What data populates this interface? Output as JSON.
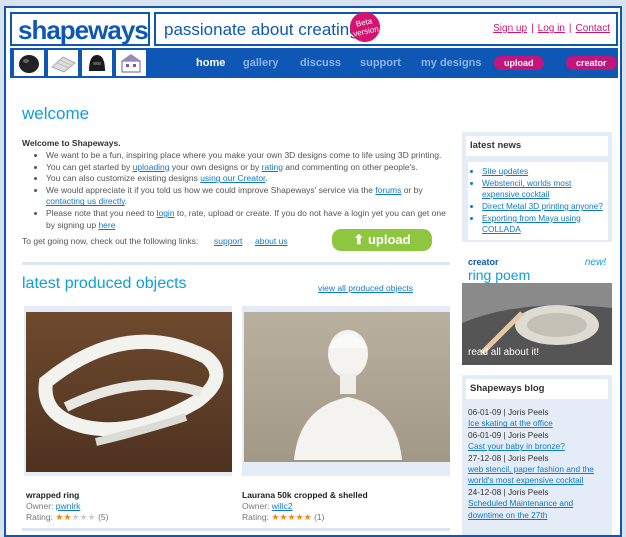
{
  "header": {
    "logo": "shapeways",
    "tagline": "passionate about creating",
    "beta_badge": "Beta version",
    "links": [
      "Sign up",
      "Log in",
      "Contact"
    ]
  },
  "nav": {
    "thumbnails": [
      "helmet-thumbnail",
      "mesh-thumbnail",
      "vader-thumbnail",
      "house-thumbnail"
    ],
    "items": [
      {
        "label": "home",
        "active": true
      },
      {
        "label": "gallery",
        "active": false
      },
      {
        "label": "discuss",
        "active": false
      },
      {
        "label": "support",
        "active": false
      },
      {
        "label": "my designs",
        "active": false
      }
    ],
    "upload_label": "upload",
    "creator_label": "creator"
  },
  "welcome": {
    "heading": "welcome",
    "intro_title": "Welcome to Shapeways.",
    "bullets": [
      {
        "parts": [
          {
            "t": "We want to be a fun, inspiring place where you make your own 3D designs come to life using 3D printing."
          }
        ]
      },
      {
        "parts": [
          {
            "t": "You can get started by "
          },
          {
            "t": "uploading",
            "link": true
          },
          {
            "t": " your own designs or by "
          },
          {
            "t": "rating",
            "link": true
          },
          {
            "t": " and commenting on other people's."
          }
        ]
      },
      {
        "parts": [
          {
            "t": "You can also customize existing designs "
          },
          {
            "t": "using our Creator",
            "link": true
          },
          {
            "t": "."
          }
        ]
      },
      {
        "parts": [
          {
            "t": "We would appreciate it if you told us how we could improve Shapeways' service via the "
          },
          {
            "t": "forums",
            "link": true
          },
          {
            "t": " or by "
          },
          {
            "t": "contacting us directly",
            "link": true
          },
          {
            "t": "."
          }
        ]
      },
      {
        "parts": [
          {
            "t": "Please note that you need to "
          },
          {
            "t": "login",
            "link": true
          },
          {
            "t": " to, rate, upload or create. If you do not have a login yet you can get one by signing up "
          },
          {
            "t": "here",
            "link": true
          }
        ]
      }
    ],
    "get_going": "To get going now, check out the following links:",
    "get_going_links": [
      "support",
      "about us"
    ],
    "upload_button": "upload"
  },
  "produced": {
    "heading": "latest produced objects",
    "view_all": "view all produced objects",
    "owner_label": "Owner:",
    "rating_label": "Rating:",
    "items": [
      {
        "title": "wrapped ring",
        "owner": "pwnlrk",
        "rating": 2,
        "max": 5,
        "votes": "(5)"
      },
      {
        "title": "Laurana 50k cropped & shelled",
        "owner": "willc2",
        "rating": 5,
        "max": 5,
        "votes": "(1)"
      }
    ]
  },
  "sidebar": {
    "news_title": "latest news",
    "news": [
      "Site updates",
      "Webstencil, worlds most expensive cocktail",
      "Direct Metal 3D printing anyone?",
      "Exporting from Maya using COLLADA"
    ],
    "creator_kicker": "creator",
    "creator_title": "ring poem",
    "creator_new": "new!",
    "creator_read": "read all about it!",
    "blog_title": "Shapeways blog",
    "blog": [
      {
        "meta": "06-01-09 | Joris Peels",
        "post": "Ice skating at the office"
      },
      {
        "meta": "06-01-09 | Joris Peels",
        "post": "Cast your baby in bronze?"
      },
      {
        "meta": "27-12-08 | Joris Peels",
        "post": "web stencil, paper fashion and the world's most expensive cocktail"
      },
      {
        "meta": "24-12-08 | Joris Peels",
        "post": "Scheduled Maintenance and downtime on the 27th"
      }
    ]
  },
  "colors": {
    "brand_blue": "#0f57b4",
    "accent_cyan": "#0f9ed8",
    "magenta": "#c0157a",
    "green": "#8ec63f",
    "star": "#f08a1c"
  }
}
